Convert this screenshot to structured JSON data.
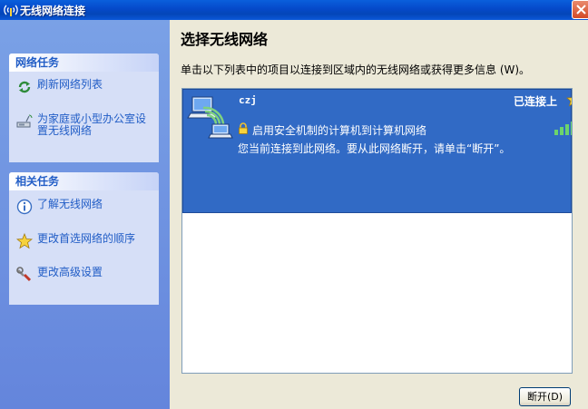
{
  "window": {
    "title": "无线网络连接",
    "title_icon": "wireless-antenna-icon"
  },
  "sidebar": {
    "network_tasks": {
      "header": "网络任务",
      "items": [
        {
          "label": "刷新网络列表",
          "icon": "refresh-icon"
        },
        {
          "label": "为家庭或小型办公室设置无线网络",
          "icon": "setup-wireless-icon"
        }
      ]
    },
    "related_tasks": {
      "header": "相关任务",
      "items": [
        {
          "label": "了解无线网络",
          "icon": "info-icon"
        },
        {
          "label": "更改首选网络的顺序",
          "icon": "star-icon"
        },
        {
          "label": "更改高级设置",
          "icon": "settings-wrench-icon"
        }
      ]
    }
  },
  "main": {
    "title": "选择无线网络",
    "description": "单击以下列表中的项目以连接到区域内的无线网络或获得更多信息 (W)。",
    "networks": [
      {
        "ssid": "czj",
        "status": "已连接上",
        "security": "启用安全机制的计算机到计算机网络",
        "message": "您当前连接到此网络。要从此网络断开，请单击“断开”。",
        "signal_bars": 5
      }
    ],
    "disconnect_button": "断开(D)"
  },
  "colors": {
    "selection": "#316ac5",
    "sidebar": "#7aa1e6",
    "panel": "#d6dff7",
    "link": "#215dc6"
  }
}
